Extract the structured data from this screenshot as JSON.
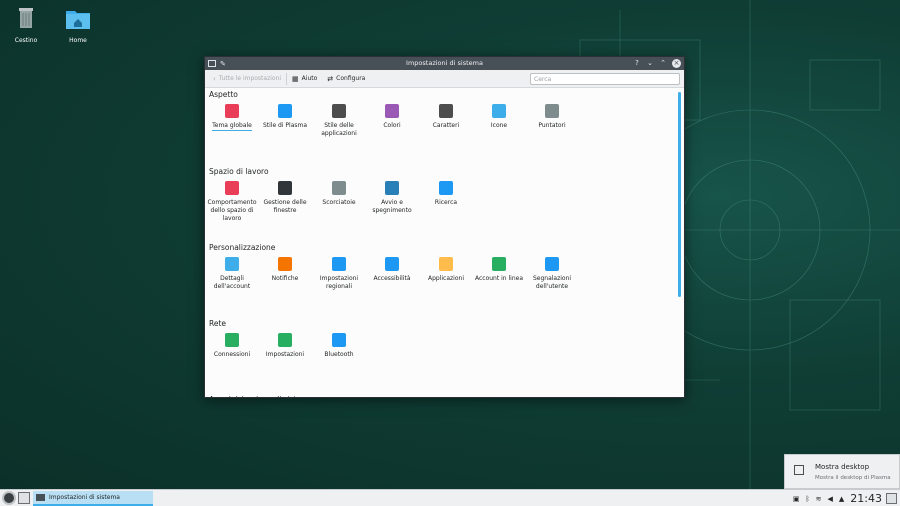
{
  "desktop": {
    "icons": [
      {
        "label": "Cestino",
        "icon": "trash-icon"
      },
      {
        "label": "Home",
        "icon": "home-folder-icon"
      }
    ]
  },
  "window": {
    "title": "Impostazioni di sistema",
    "controls": {
      "help": "?",
      "minimize": "⌄",
      "maximize": "⌃",
      "close": "×"
    },
    "toolbar": {
      "back_label": "Tutte le impostazioni",
      "help_label": "Aiuto",
      "configure_label": "Configura",
      "search_placeholder": "Cerca"
    },
    "sections": [
      {
        "title": "Aspetto",
        "items": [
          {
            "label": "Tema globale",
            "icon": "global-theme-icon",
            "color": "#e93d58",
            "selected": true
          },
          {
            "label": "Stile di Plasma",
            "icon": "plasma-style-icon",
            "color": "#1d99f3"
          },
          {
            "label": "Stile delle applicazioni",
            "icon": "app-style-icon",
            "color": "#4d4d4d"
          },
          {
            "label": "Colori",
            "icon": "colors-icon",
            "color": "#9b59b6"
          },
          {
            "label": "Caratteri",
            "icon": "fonts-icon",
            "color": "#4d4d4d"
          },
          {
            "label": "Icone",
            "icon": "icons-icon",
            "color": "#3daee9"
          },
          {
            "label": "Puntatori",
            "icon": "cursors-icon",
            "color": "#7f8c8d"
          }
        ]
      },
      {
        "title": "Spazio di lavoro",
        "items": [
          {
            "label": "Comportamento dello spazio di lavoro",
            "icon": "workspace-behavior-icon",
            "color": "#e93d58"
          },
          {
            "label": "Gestione delle finestre",
            "icon": "window-management-icon",
            "color": "#31363b"
          },
          {
            "label": "Scorciatoie",
            "icon": "keyboard-icon",
            "color": "#7f8c8d"
          },
          {
            "label": "Avvio e spegnimento",
            "icon": "startup-shutdown-icon",
            "color": "#2980b9"
          },
          {
            "label": "Ricerca",
            "icon": "search-icon",
            "color": "#1d99f3"
          }
        ]
      },
      {
        "title": "Personalizzazione",
        "items": [
          {
            "label": "Dettagli dell'account",
            "icon": "account-details-icon",
            "color": "#3daee9"
          },
          {
            "label": "Notifiche",
            "icon": "bell-icon",
            "color": "#f67400"
          },
          {
            "label": "Impostazioni regionali",
            "icon": "regional-settings-icon",
            "color": "#1d99f3"
          },
          {
            "label": "Accessibilità",
            "icon": "accessibility-icon",
            "color": "#1d99f3"
          },
          {
            "label": "Applicazioni",
            "icon": "applications-icon",
            "color": "#fdbc4b"
          },
          {
            "label": "Account in linea",
            "icon": "online-accounts-icon",
            "color": "#27ae60"
          },
          {
            "label": "Segnalazioni dell'utente",
            "icon": "user-feedback-icon",
            "color": "#1d99f3"
          }
        ]
      },
      {
        "title": "Rete",
        "items": [
          {
            "label": "Connessioni",
            "icon": "connections-globe-icon",
            "color": "#27ae60"
          },
          {
            "label": "Impostazioni",
            "icon": "network-settings-globe-icon",
            "color": "#27ae60"
          },
          {
            "label": "Bluetooth",
            "icon": "bluetooth-icon",
            "color": "#1d99f3"
          }
        ]
      },
      {
        "title": "Amministrazione di sistema",
        "items": []
      }
    ]
  },
  "notification": {
    "title": "Mostra desktop",
    "subtitle": "Mostra il desktop di Plasma"
  },
  "taskbar": {
    "task_label": "Impostazioni di sistema",
    "clock": "21:43",
    "tray_icons": [
      "clipboard-icon",
      "bluetooth-icon",
      "wifi-icon",
      "volume-icon",
      "expand-arrow-icon"
    ]
  }
}
